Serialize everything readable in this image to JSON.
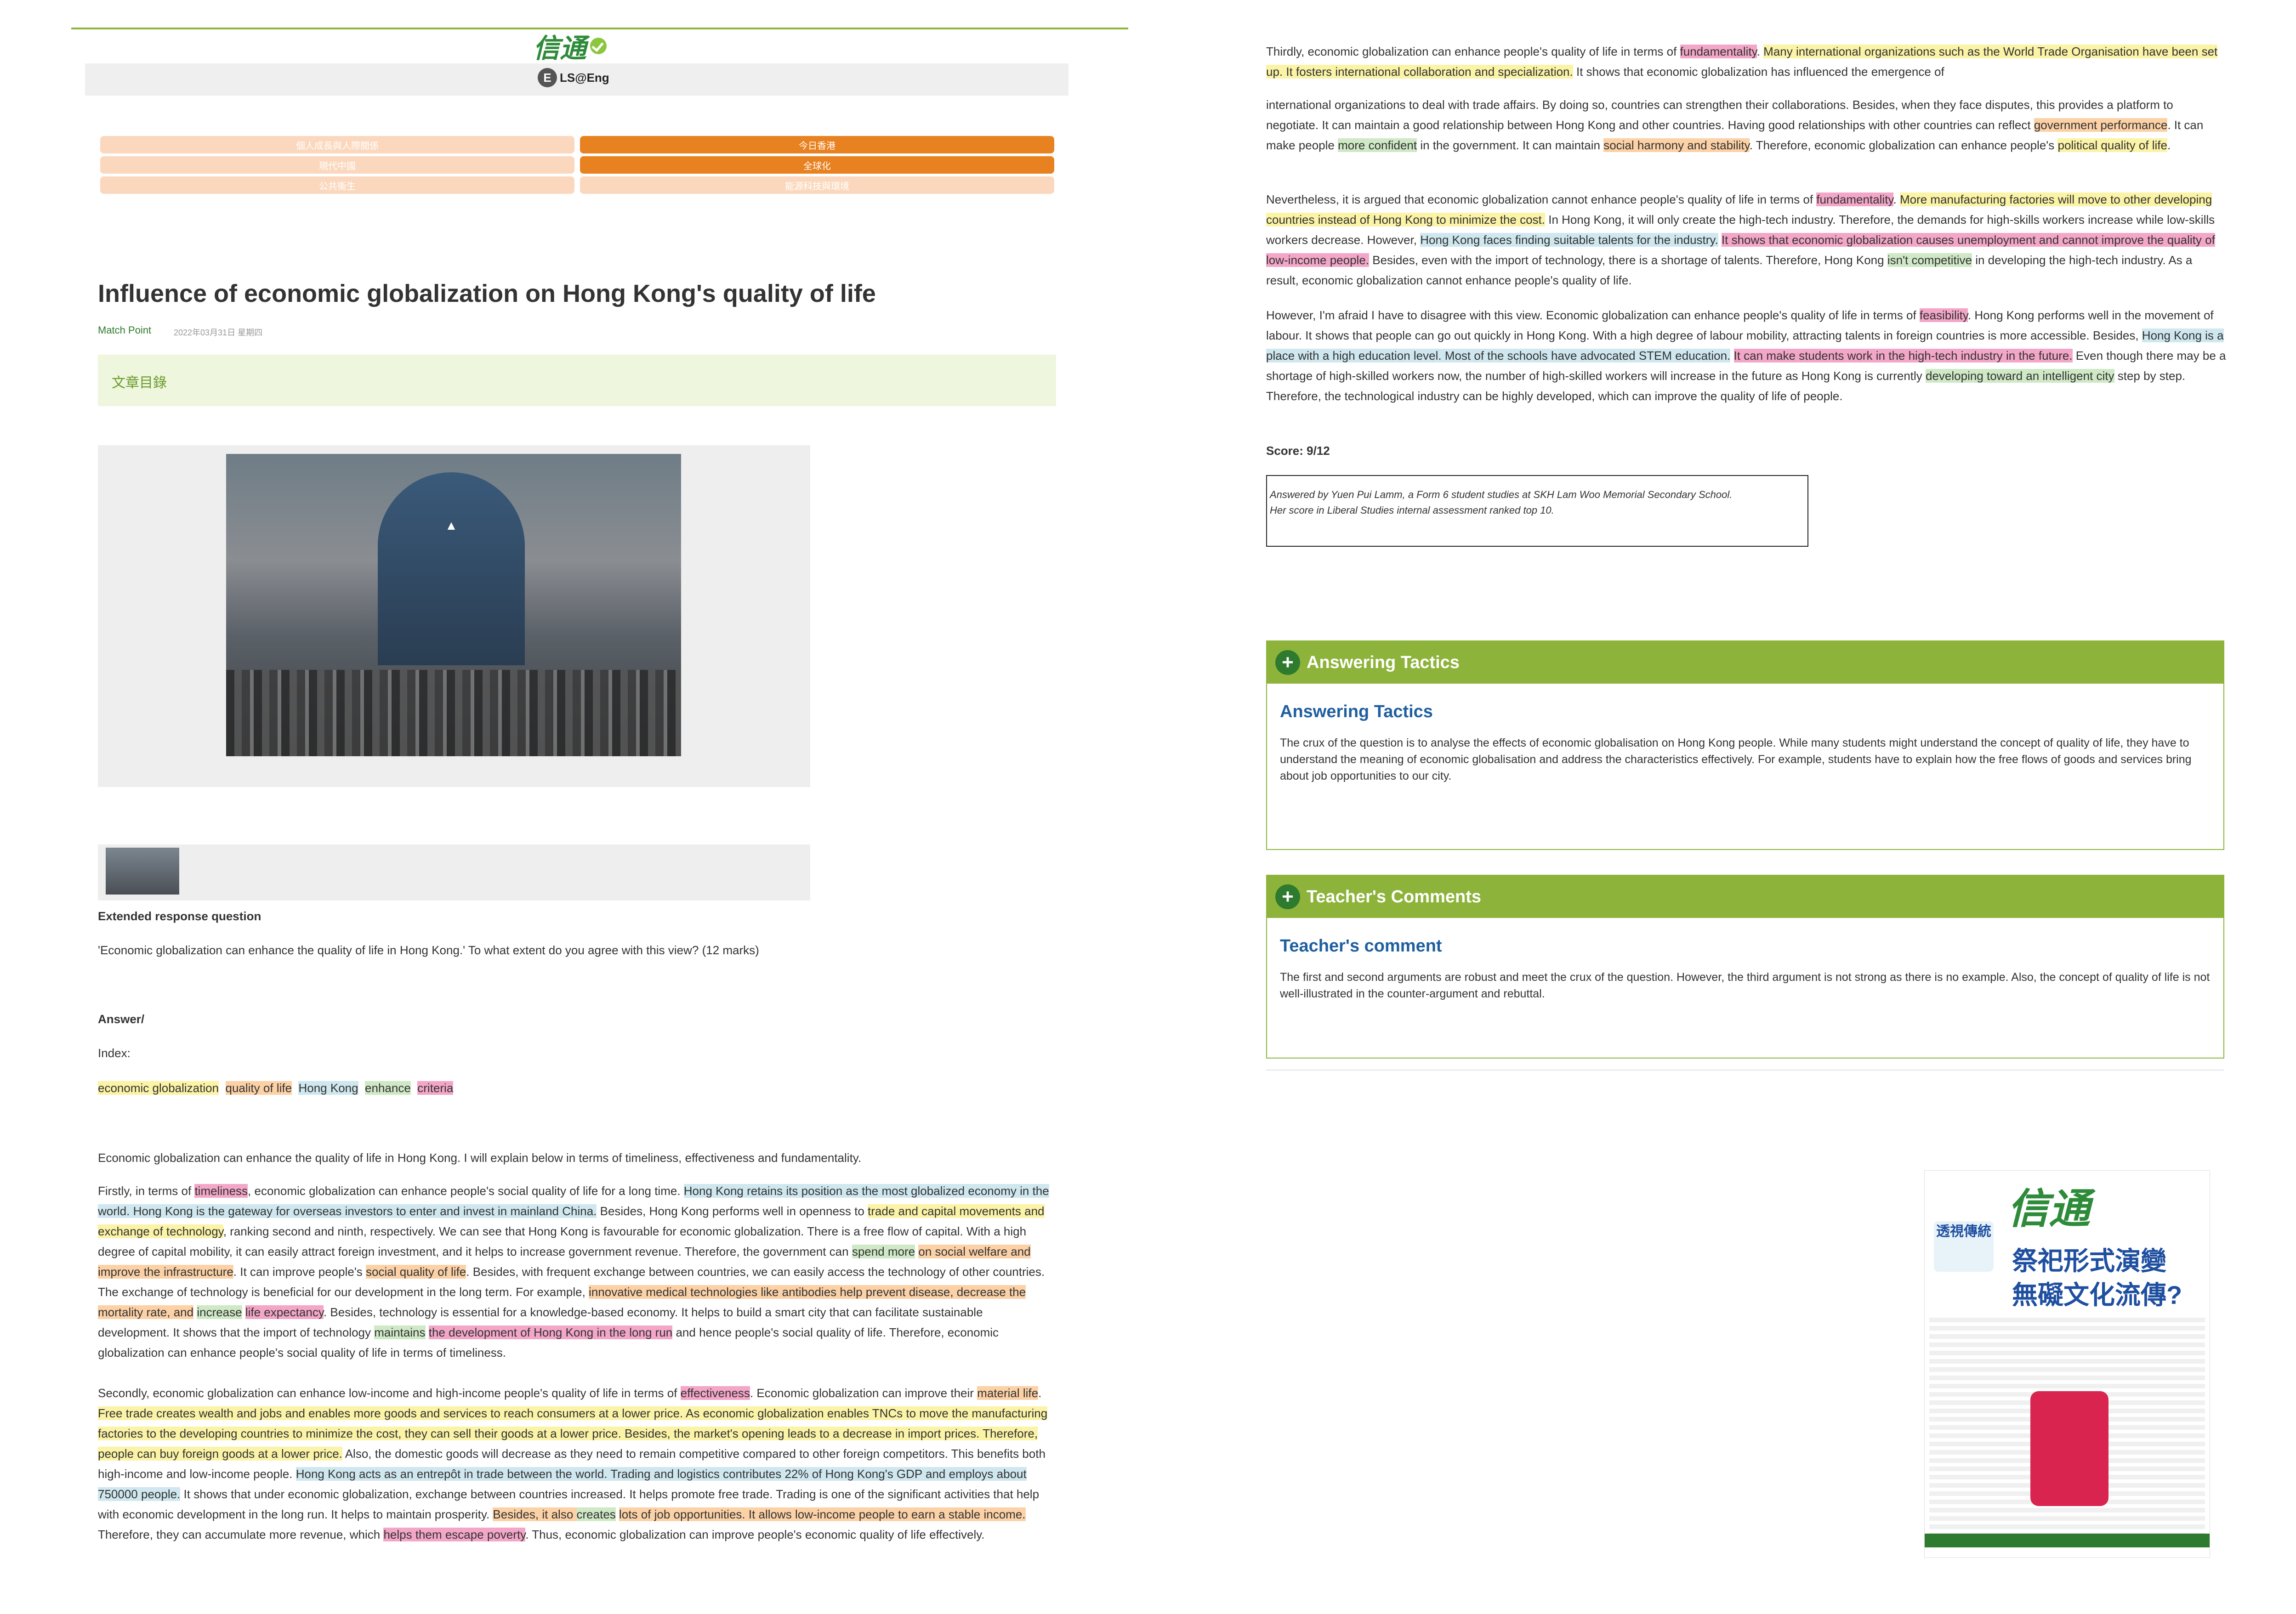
{
  "header": {
    "logo_text": "信通",
    "site_badge": "E",
    "site_name": "LS@Eng",
    "nav": [
      {
        "label": "個人成長與人際關係",
        "active": false
      },
      {
        "label": "今日香港",
        "active": true
      },
      {
        "label": "現代中國",
        "active": false
      },
      {
        "label": "全球化",
        "active": true
      },
      {
        "label": "公共衞生",
        "active": false
      },
      {
        "label": "能源科技與環境",
        "active": false
      }
    ]
  },
  "article": {
    "title": "Influence of economic globalization on Hong Kong's quality of life",
    "author": "Match Point",
    "date": "2022年03月31日 星期四",
    "toc_label": "文章目錄",
    "question_heading": "Extended response question",
    "question": "'Economic globalization can enhance the quality of life in Hong Kong.' To what extent do you agree with this view? (12 marks)",
    "answer_heading": "Answer/",
    "index_label": "Index:",
    "index_tags": [
      "economic globalization",
      "quality of life",
      "Hong Kong",
      "enhance",
      "criteria"
    ],
    "intro": "Economic globalization can enhance the quality of life in Hong Kong. I will explain below in terms of timeliness, effectiveness and fundamentality.",
    "para1": [
      "Firstly, in terms of ",
      "timeliness",
      ", economic globalization can enhance people's social quality of life for a long time. ",
      "Hong Kong retains its position as the most globalized economy in the world. Hong Kong is the gateway for overseas investors to enter and invest in mainland China.",
      " Besides, Hong Kong performs well in openness to ",
      "trade and capital movements and exchange of technology",
      ", ranking second and ninth, respectively. We can see that Hong Kong is favourable for economic globalization. There is a free flow of capital. With a high degree of capital mobility, it can easily attract foreign investment, and it helps to increase government revenue. Therefore, the government can ",
      "spend more",
      " ",
      "on social welfare and improve the infrastructure",
      ". It can improve people's ",
      "social quality of life",
      ". Besides, with frequent exchange between countries, we can easily access the technology of other countries. The exchange of technology is beneficial for our development in the long term. For example, ",
      "innovative medical technologies like antibodies help prevent disease, decrease the mortality rate, and",
      " ",
      "increase",
      " ",
      "life expectancy",
      ". Besides, technology is essential for a knowledge-based economy. It helps to build a smart city that can facilitate sustainable development. It shows that the import of technology ",
      "maintains",
      " ",
      "the development of Hong Kong in the long run",
      " and hence people's social quality of life. Therefore, economic globalization can enhance people's social quality of life in terms of timeliness."
    ],
    "para2": [
      "Secondly, economic globalization can enhance low-income and high-income people's quality of life in terms of ",
      "effectiveness",
      ". Economic globalization can improve their ",
      "material life",
      ". ",
      "Free trade creates wealth and jobs and enables more goods and services to reach consumers at a lower price. As economic globalization enables TNCs to move the manufacturing factories to the developing countries to minimize the cost, they can sell their goods at a lower price. Besides, the market's opening leads to a decrease in import prices. Therefore, people can buy foreign goods at a lower price.",
      " Also, the domestic goods will decrease as they need to remain competitive compared to other foreign competitors. This benefits both high-income and low-income people. ",
      "Hong Kong acts as an entrepôt in trade between the world. Trading and logistics contributes 22% of Hong Kong's GDP and employs about 750000 people.",
      " It shows that under economic globalization, exchange between countries increased. It helps promote free trade. Trading is one of the significant activities that help with economic development in the long run. It helps to maintain prosperity. ",
      "Besides, it also ",
      "creates",
      " ",
      "lots of job opportunities. It allows low-income people to earn a stable income.",
      " Therefore, they can accumulate more revenue, which ",
      "helps them escape poverty",
      ". Thus, economic globalization can improve people's economic quality of life effectively."
    ],
    "para3": [
      "Thirdly, economic globalization can enhance people's quality of life in terms of ",
      "fundamentality",
      ". ",
      "Many international organizations such as the World Trade Organisation have been set up. It fosters international collaboration and specialization.",
      " It shows that economic globalization has influenced the emergence of"
    ],
    "para3b": [
      "international organizations to deal with trade affairs. By doing so, countries can strengthen their collaborations. Besides, when they face disputes, this provides a platform to negotiate. It can maintain a good relationship between Hong Kong and other countries. Having good relationships with other countries can reflect ",
      "government performance",
      ". It can make people ",
      "more confident",
      " in the government. It can maintain ",
      "social harmony and stability",
      ". Therefore, economic globalization can enhance people's ",
      "political quality of life",
      "."
    ],
    "para4": [
      "Nevertheless, it is argued that economic globalization cannot enhance people's quality of life in terms of ",
      "fundamentality",
      ". ",
      "More manufacturing factories will move to other developing countries instead of Hong Kong to minimize the cost.",
      " In Hong Kong, it will only create the high-tech industry. Therefore, the demands for high-skills workers increase while low-skills workers decrease. However, ",
      "Hong Kong faces finding suitable talents for the industry.",
      " ",
      "It shows that economic globalization causes unemployment and cannot improve the quality of low-income people.",
      " Besides, even with the import of technology, there is a shortage of talents. Therefore, Hong Kong ",
      "isn't competitive",
      " in developing the high-tech industry. As a result, economic globalization cannot enhance people's quality of life."
    ],
    "para5": [
      "However, I'm afraid I have to disagree with this view. Economic globalization can enhance people's quality of life in terms of ",
      "feasibility",
      ". Hong Kong performs well in the movement of labour. It shows that people can go out quickly in Hong Kong. With a high degree of labour mobility, attracting talents in foreign countries is more accessible. Besides, ",
      "Hong Kong is a place with a high education level. Most of the schools have advocated STEM education.",
      " ",
      "It can make students work in the high-tech industry in the future.",
      " Even though there may be a shortage of high-skilled workers now, the number of high-skilled workers will increase in the future as Hong Kong is currently ",
      "developing toward an intelligent city",
      " step by step. Therefore, the technological industry can be highly developed, which can improve the quality of life of people."
    ],
    "score": "Score: 9/12",
    "answered_by": [
      "Answered by Yuen Pui Lamm, a Form 6 student studies at SKH Lam Woo Memorial Secondary School.",
      "Her score in Liberal Studies internal assessment ranked top 10."
    ]
  },
  "tactics": {
    "header": "Answering Tactics",
    "title": "Answering Tactics",
    "body": "The crux of the question is to analyse the effects of economic globalisation on Hong Kong people. While many students might understand the concept of quality of life, they have to understand the meaning of economic globalisation and address the characteristics effectively. For example, students have to explain how the free flows of goods and services bring about job opportunities to our city."
  },
  "comments": {
    "header": "Teacher's Comments",
    "title": "Teacher's comment",
    "body": "The first and second arguments are robust and meet the crux of the question. However, the third argument is not strong as there is no example. Also, the concept of quality of life is not well-illustrated in the counter-argument and rebuttal."
  },
  "newspaper": {
    "masthead": "信通",
    "badge": "透視傳統",
    "headline": "祭祀形式演變\n無礙文化流傳?"
  },
  "colors": {
    "accent_green": "#8db33a",
    "nav_orange": "#e8811f",
    "nav_light": "#fbd8bd",
    "hl_yellow": "#fbf3a6",
    "hl_orange": "#fcd1a6",
    "hl_pink": "#f3a6c8",
    "hl_blue": "#cfe7ef",
    "hl_green": "#cfe9c6"
  }
}
